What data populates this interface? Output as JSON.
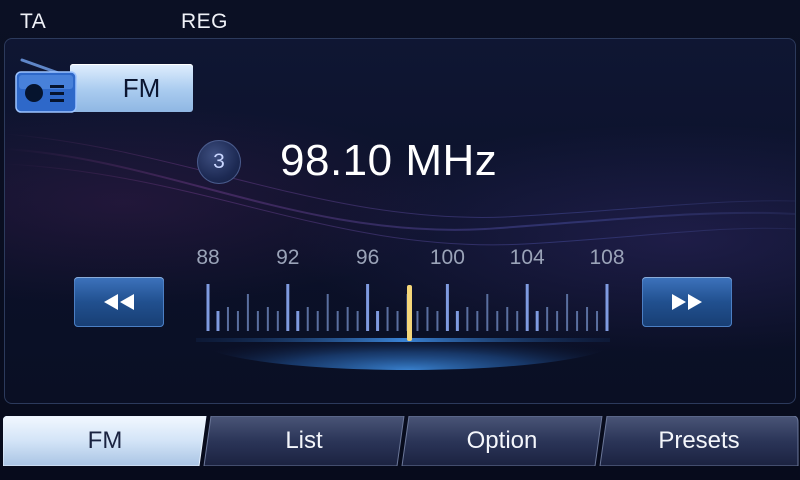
{
  "status": {
    "ta": "TA",
    "reg": "REG"
  },
  "band": {
    "label": "FM",
    "icon": "radio-icon"
  },
  "station": {
    "preset_number": "3",
    "frequency": "98.10 MHz"
  },
  "tuner": {
    "scale_labels": [
      "88",
      "92",
      "96",
      "100",
      "104",
      "108"
    ],
    "min": 88,
    "max": 108,
    "current": 98.1,
    "indicator_color": "#f5d77a"
  },
  "seek": {
    "back_icon": "rewind-icon",
    "forward_icon": "fast-forward-icon"
  },
  "tabs": [
    {
      "label": "FM",
      "active": true
    },
    {
      "label": "List",
      "active": false
    },
    {
      "label": "Option",
      "active": false
    },
    {
      "label": "Presets",
      "active": false
    }
  ],
  "colors": {
    "accent": "#2a5ca3",
    "active_tab": "#d9e8fa",
    "background": "#0b1129"
  }
}
